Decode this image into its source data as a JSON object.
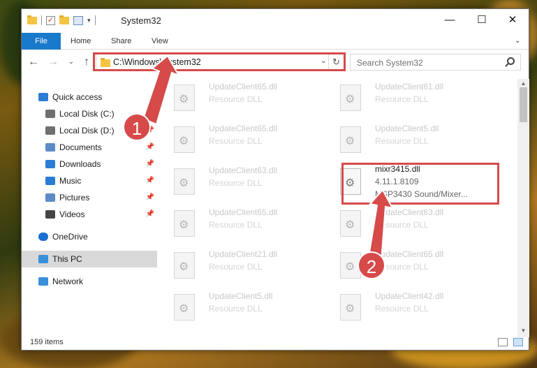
{
  "window": {
    "title": "System32",
    "controls": {
      "minimize": "—",
      "maximize": "☐",
      "close": "✕"
    }
  },
  "ribbon": {
    "file_tab": "File",
    "tabs": [
      "Home",
      "Share",
      "View"
    ]
  },
  "nav": {
    "back": "←",
    "forward": "→",
    "recent": "⌄",
    "up": "↑",
    "address": "C:\\Windows\\System32",
    "search_placeholder": "Search System32"
  },
  "sidebar": {
    "items": [
      {
        "label": "Quick access",
        "icon": "star-icon",
        "pinned": false
      },
      {
        "label": "Local Disk (C:)",
        "icon": "drive-icon",
        "pinned": false
      },
      {
        "label": "Local Disk (D:)",
        "icon": "drive-icon",
        "pinned": true
      },
      {
        "label": "Documents",
        "icon": "documents-icon",
        "pinned": true
      },
      {
        "label": "Downloads",
        "icon": "downloads-icon",
        "pinned": true
      },
      {
        "label": "Music",
        "icon": "music-icon",
        "pinned": true
      },
      {
        "label": "Pictures",
        "icon": "pictures-icon",
        "pinned": true
      },
      {
        "label": "Videos",
        "icon": "videos-icon",
        "pinned": true
      },
      {
        "label": "OneDrive",
        "icon": "cloud-icon",
        "pinned": false
      },
      {
        "label": "This PC",
        "icon": "computer-icon",
        "pinned": false,
        "selected": true
      },
      {
        "label": "Network",
        "icon": "network-icon",
        "pinned": false
      }
    ],
    "pin_glyph": "📌"
  },
  "files": [
    {
      "name": "UpdateClient65.dll",
      "type": "Resource DLL"
    },
    {
      "name": "UpdateClient61.dll",
      "type": "Resource DLL"
    },
    {
      "name": "UpdateClient65.dll",
      "type": "Resource DLL"
    },
    {
      "name": "UpdateClient5.dll",
      "type": "Resource DLL"
    },
    {
      "name": "UpdateClient63.dll",
      "type": "Resource DLL"
    },
    {
      "name": "mixr3415.dll",
      "version": "4.11.1.8109",
      "description": "MSP3430 Sound/Mixer...",
      "focus": true
    },
    {
      "name": "UpdateClient65.dll",
      "type": "Resource DLL"
    },
    {
      "name": "UpdateClient63.dll",
      "type": "Resource DLL"
    },
    {
      "name": "UpdateClient21.dll",
      "type": "Resource DLL"
    },
    {
      "name": "UpdateClient65.dll",
      "type": "Resource DLL"
    },
    {
      "name": "UpdateClient5.dll",
      "type": "Resource DLL"
    },
    {
      "name": "UpdateClient42.dll",
      "type": "Resource DLL"
    }
  ],
  "status": {
    "item_count": "159 items"
  },
  "annotations": {
    "marker_1": "1",
    "marker_2": "2",
    "highlight_color": "#d64a4a"
  }
}
